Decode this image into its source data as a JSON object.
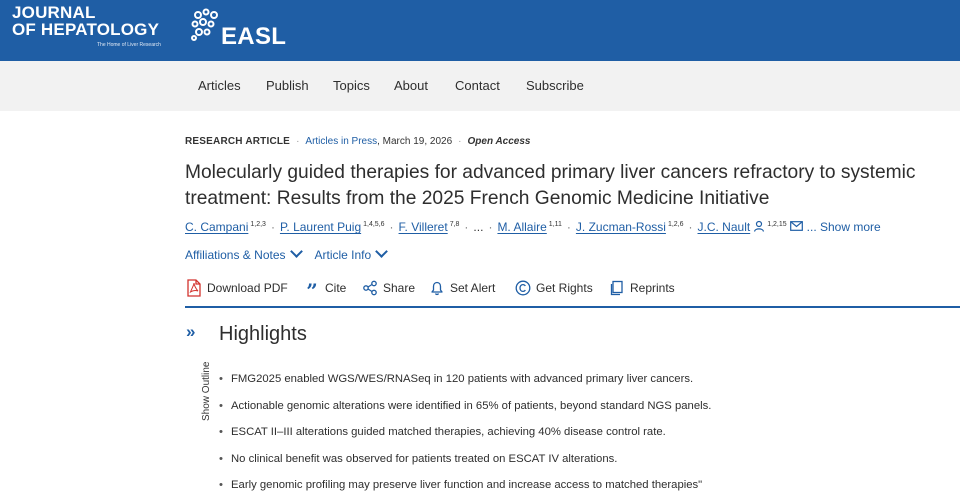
{
  "brand": {
    "journal_line1": "JOURNAL",
    "journal_line2": "OF HEPATOLOGY",
    "journal_tagline": "The Home of Liver Research",
    "society": "EASL"
  },
  "nav": [
    "Articles",
    "Publish",
    "Topics",
    "About",
    "Contact",
    "Subscribe"
  ],
  "meta": {
    "type": "RESEARCH ARTICLE",
    "status": "Articles in Press",
    "date": "March 19, 2026",
    "access": "Open Access"
  },
  "title": "Molecularly guided therapies for advanced primary liver cancers refractory to systemic treatment: Results from the 2025 French Genomic Medicine Initiative",
  "authors": [
    {
      "name": "C. Campani",
      "sup": "1,2,3"
    },
    {
      "name": "P. Laurent Puig",
      "sup": "1,4,5,6"
    },
    {
      "name": "F. Villeret",
      "sup": "7,8"
    },
    {
      "name": "M. Allaire",
      "sup": "1,11"
    },
    {
      "name": "J. Zucman-Rossi",
      "sup": "1,2,6"
    },
    {
      "name": "J.C. Nault",
      "sup": "1,2,15"
    }
  ],
  "ellipsis": "...",
  "show_more": "... Show more",
  "links": {
    "affiliations": "Affiliations & Notes",
    "article_info": "Article Info"
  },
  "actions": [
    {
      "label": "Download PDF",
      "icon": "pdf-icon"
    },
    {
      "label": "Cite",
      "icon": "quote-icon"
    },
    {
      "label": "Share",
      "icon": "share-icon"
    },
    {
      "label": "Set Alert",
      "icon": "bell-icon"
    },
    {
      "label": "Get Rights",
      "icon": "copyright-icon"
    },
    {
      "label": "Reprints",
      "icon": "reprints-icon"
    }
  ],
  "outline": {
    "label": "Show Outline",
    "toggle": "»"
  },
  "highlights": {
    "heading": "Highlights",
    "items": [
      "FMG2025 enabled WGS/WES/RNASeq in 120 patients with advanced primary liver cancers.",
      "Actionable genomic alterations were identified in 65% of patients, beyond standard NGS panels.",
      "ESCAT II–III alterations guided matched therapies, achieving 40% disease control rate.",
      "No clinical benefit was observed for patients treated on ESCAT IV alterations.",
      "Early genomic profiling may preserve liver function and increase access to matched therapies\""
    ]
  },
  "colors": {
    "brand_blue": "#1f5ea5",
    "nav_bg": "#f2f2f2",
    "pdf_red": "#d2322d"
  }
}
